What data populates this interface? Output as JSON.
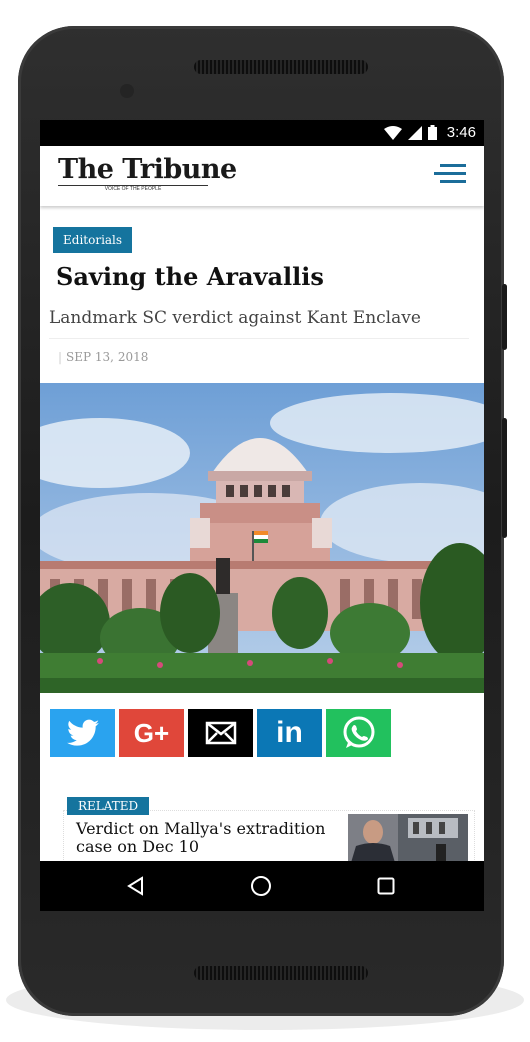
{
  "statusbar": {
    "time": "3:46",
    "icons": [
      "wifi-icon",
      "signal-icon",
      "battery-icon"
    ]
  },
  "header": {
    "logo": "The Tribune",
    "tagline": "VOICE OF THE PEOPLE",
    "menu_icon": "hamburger-icon"
  },
  "article": {
    "category": "Editorials",
    "title": "Saving the Aravallis",
    "subtitle": "Landmark SC verdict against Kant Enclave",
    "date": "SEP 13, 2018"
  },
  "share": {
    "buttons": [
      {
        "name": "twitter",
        "color": "#2aa3ef",
        "icon": "twitter-icon"
      },
      {
        "name": "google-plus",
        "color": "#e0473a",
        "icon": "google-plus-icon",
        "label": "G+"
      },
      {
        "name": "email",
        "color": "#000000",
        "icon": "email-icon"
      },
      {
        "name": "linkedin",
        "color": "#0b77b5",
        "icon": "linkedin-icon",
        "label": "in"
      },
      {
        "name": "whatsapp",
        "color": "#22c15e",
        "icon": "whatsapp-icon"
      }
    ]
  },
  "related": {
    "label": "RELATED",
    "title": "Verdict on Mallya's extradition case on Dec 10"
  },
  "navigation": {
    "buttons": [
      "back-icon",
      "home-icon",
      "recents-icon"
    ]
  },
  "colors": {
    "accent": "#15749e",
    "menu": "#1b6d9a"
  }
}
